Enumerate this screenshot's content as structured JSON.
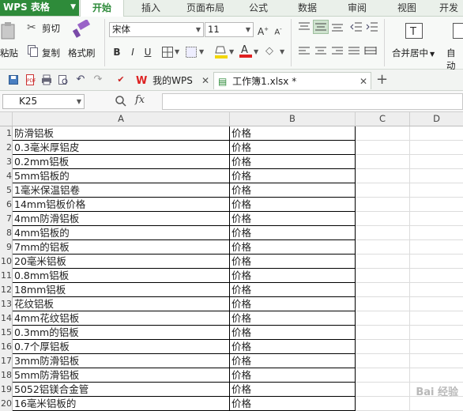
{
  "app": {
    "menu_label": "WPS 表格"
  },
  "ribbon_tabs": [
    "开始",
    "插入",
    "页面布局",
    "公式",
    "数据",
    "审阅",
    "视图",
    "开发"
  ],
  "clipboard": {
    "paste_label": "粘贴",
    "cut_label": "剪切",
    "copy_label": "复制",
    "format_painter_label": "格式刷"
  },
  "font": {
    "name": "宋体",
    "size": "11",
    "bold": "B",
    "italic": "I",
    "underline": "U"
  },
  "alignment": {
    "merge_center_label": "合并居中",
    "auto_wrap_label": "自动"
  },
  "doc_tabs": {
    "wps_tab": "我的WPS",
    "file_tab": "工作簿1.xlsx *"
  },
  "formula_bar": {
    "name_box": "K25",
    "fx": "fx",
    "content": ""
  },
  "columns": [
    "A",
    "B",
    "C",
    "D"
  ],
  "rows": [
    {
      "num": "1",
      "a": "防滑铝板",
      "b": "价格"
    },
    {
      "num": "2",
      "a": "0.3毫米厚铝皮",
      "b": "价格"
    },
    {
      "num": "3",
      "a": "0.2mm铝板",
      "b": "价格"
    },
    {
      "num": "4",
      "a": "5mm铝板的",
      "b": "价格"
    },
    {
      "num": "5",
      "a": "1毫米保温铝卷",
      "b": "价格"
    },
    {
      "num": "6",
      "a": "14mm铝板价格",
      "b": "价格"
    },
    {
      "num": "7",
      "a": "4mm防滑铝板",
      "b": "价格"
    },
    {
      "num": "8",
      "a": "4mm铝板的",
      "b": "价格"
    },
    {
      "num": "9",
      "a": "7mm的铝板",
      "b": "价格"
    },
    {
      "num": "10",
      "a": "20毫米铝板",
      "b": "价格"
    },
    {
      "num": "11",
      "a": "0.8mm铝板",
      "b": "价格"
    },
    {
      "num": "12",
      "a": "18mm铝板",
      "b": "价格"
    },
    {
      "num": "13",
      "a": "花纹铝板",
      "b": "价格"
    },
    {
      "num": "14",
      "a": "4mm花纹铝板",
      "b": "价格"
    },
    {
      "num": "15",
      "a": "0.3mm的铝板",
      "b": "价格"
    },
    {
      "num": "16",
      "a": "0.7个厚铝板",
      "b": "价格"
    },
    {
      "num": "17",
      "a": "3mm防滑铝板",
      "b": "价格"
    },
    {
      "num": "18",
      "a": "5mm防滑铝板",
      "b": "价格"
    },
    {
      "num": "19",
      "a": "5052铝镁合金管",
      "b": "价格"
    },
    {
      "num": "20",
      "a": "16毫米铝板的",
      "b": "价格"
    }
  ],
  "watermark": "Bai 经验",
  "colors": {
    "accent": "#2e8b3a",
    "font_color_bar": "#e02020",
    "highlight_bar": "#f2d600"
  }
}
